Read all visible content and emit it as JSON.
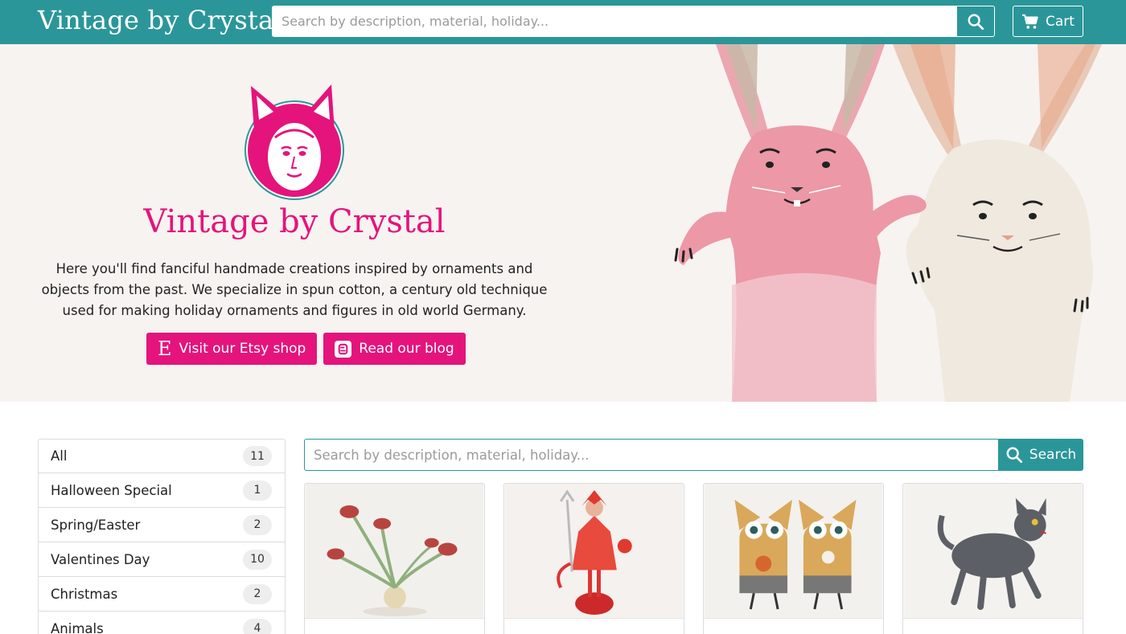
{
  "navbar": {
    "brand": "Vintage by Crystal",
    "search_placeholder": "Search by description, material, holiday...",
    "cart_label": "Cart"
  },
  "hero": {
    "title": "Vintage by Crystal",
    "description": "Here you'll find fanciful handmade creations inspired by ornaments and objects from the past. We specialize in spun cotton, a century old technique used for making holiday ornaments and figures in old world Germany.",
    "etsy_button": "Visit our Etsy shop",
    "blog_button": "Read our blog"
  },
  "categories": [
    {
      "label": "All",
      "count": "11"
    },
    {
      "label": "Halloween Special",
      "count": "1"
    },
    {
      "label": "Spring/Easter",
      "count": "2"
    },
    {
      "label": "Valentines Day",
      "count": "10"
    },
    {
      "label": "Christmas",
      "count": "2"
    },
    {
      "label": "Animals",
      "count": "4"
    }
  ],
  "main_search": {
    "placeholder": "Search by description, material, holiday...",
    "button_label": "Search"
  },
  "products": [
    {
      "icon": "venus-flytrap-plant"
    },
    {
      "icon": "red-devil-figure"
    },
    {
      "icon": "owl-figures"
    },
    {
      "icon": "black-cat-figure"
    }
  ],
  "colors": {
    "primary_teal": "#2b9699",
    "accent_pink": "#e4147c",
    "hero_bg": "#f7f3f0"
  }
}
